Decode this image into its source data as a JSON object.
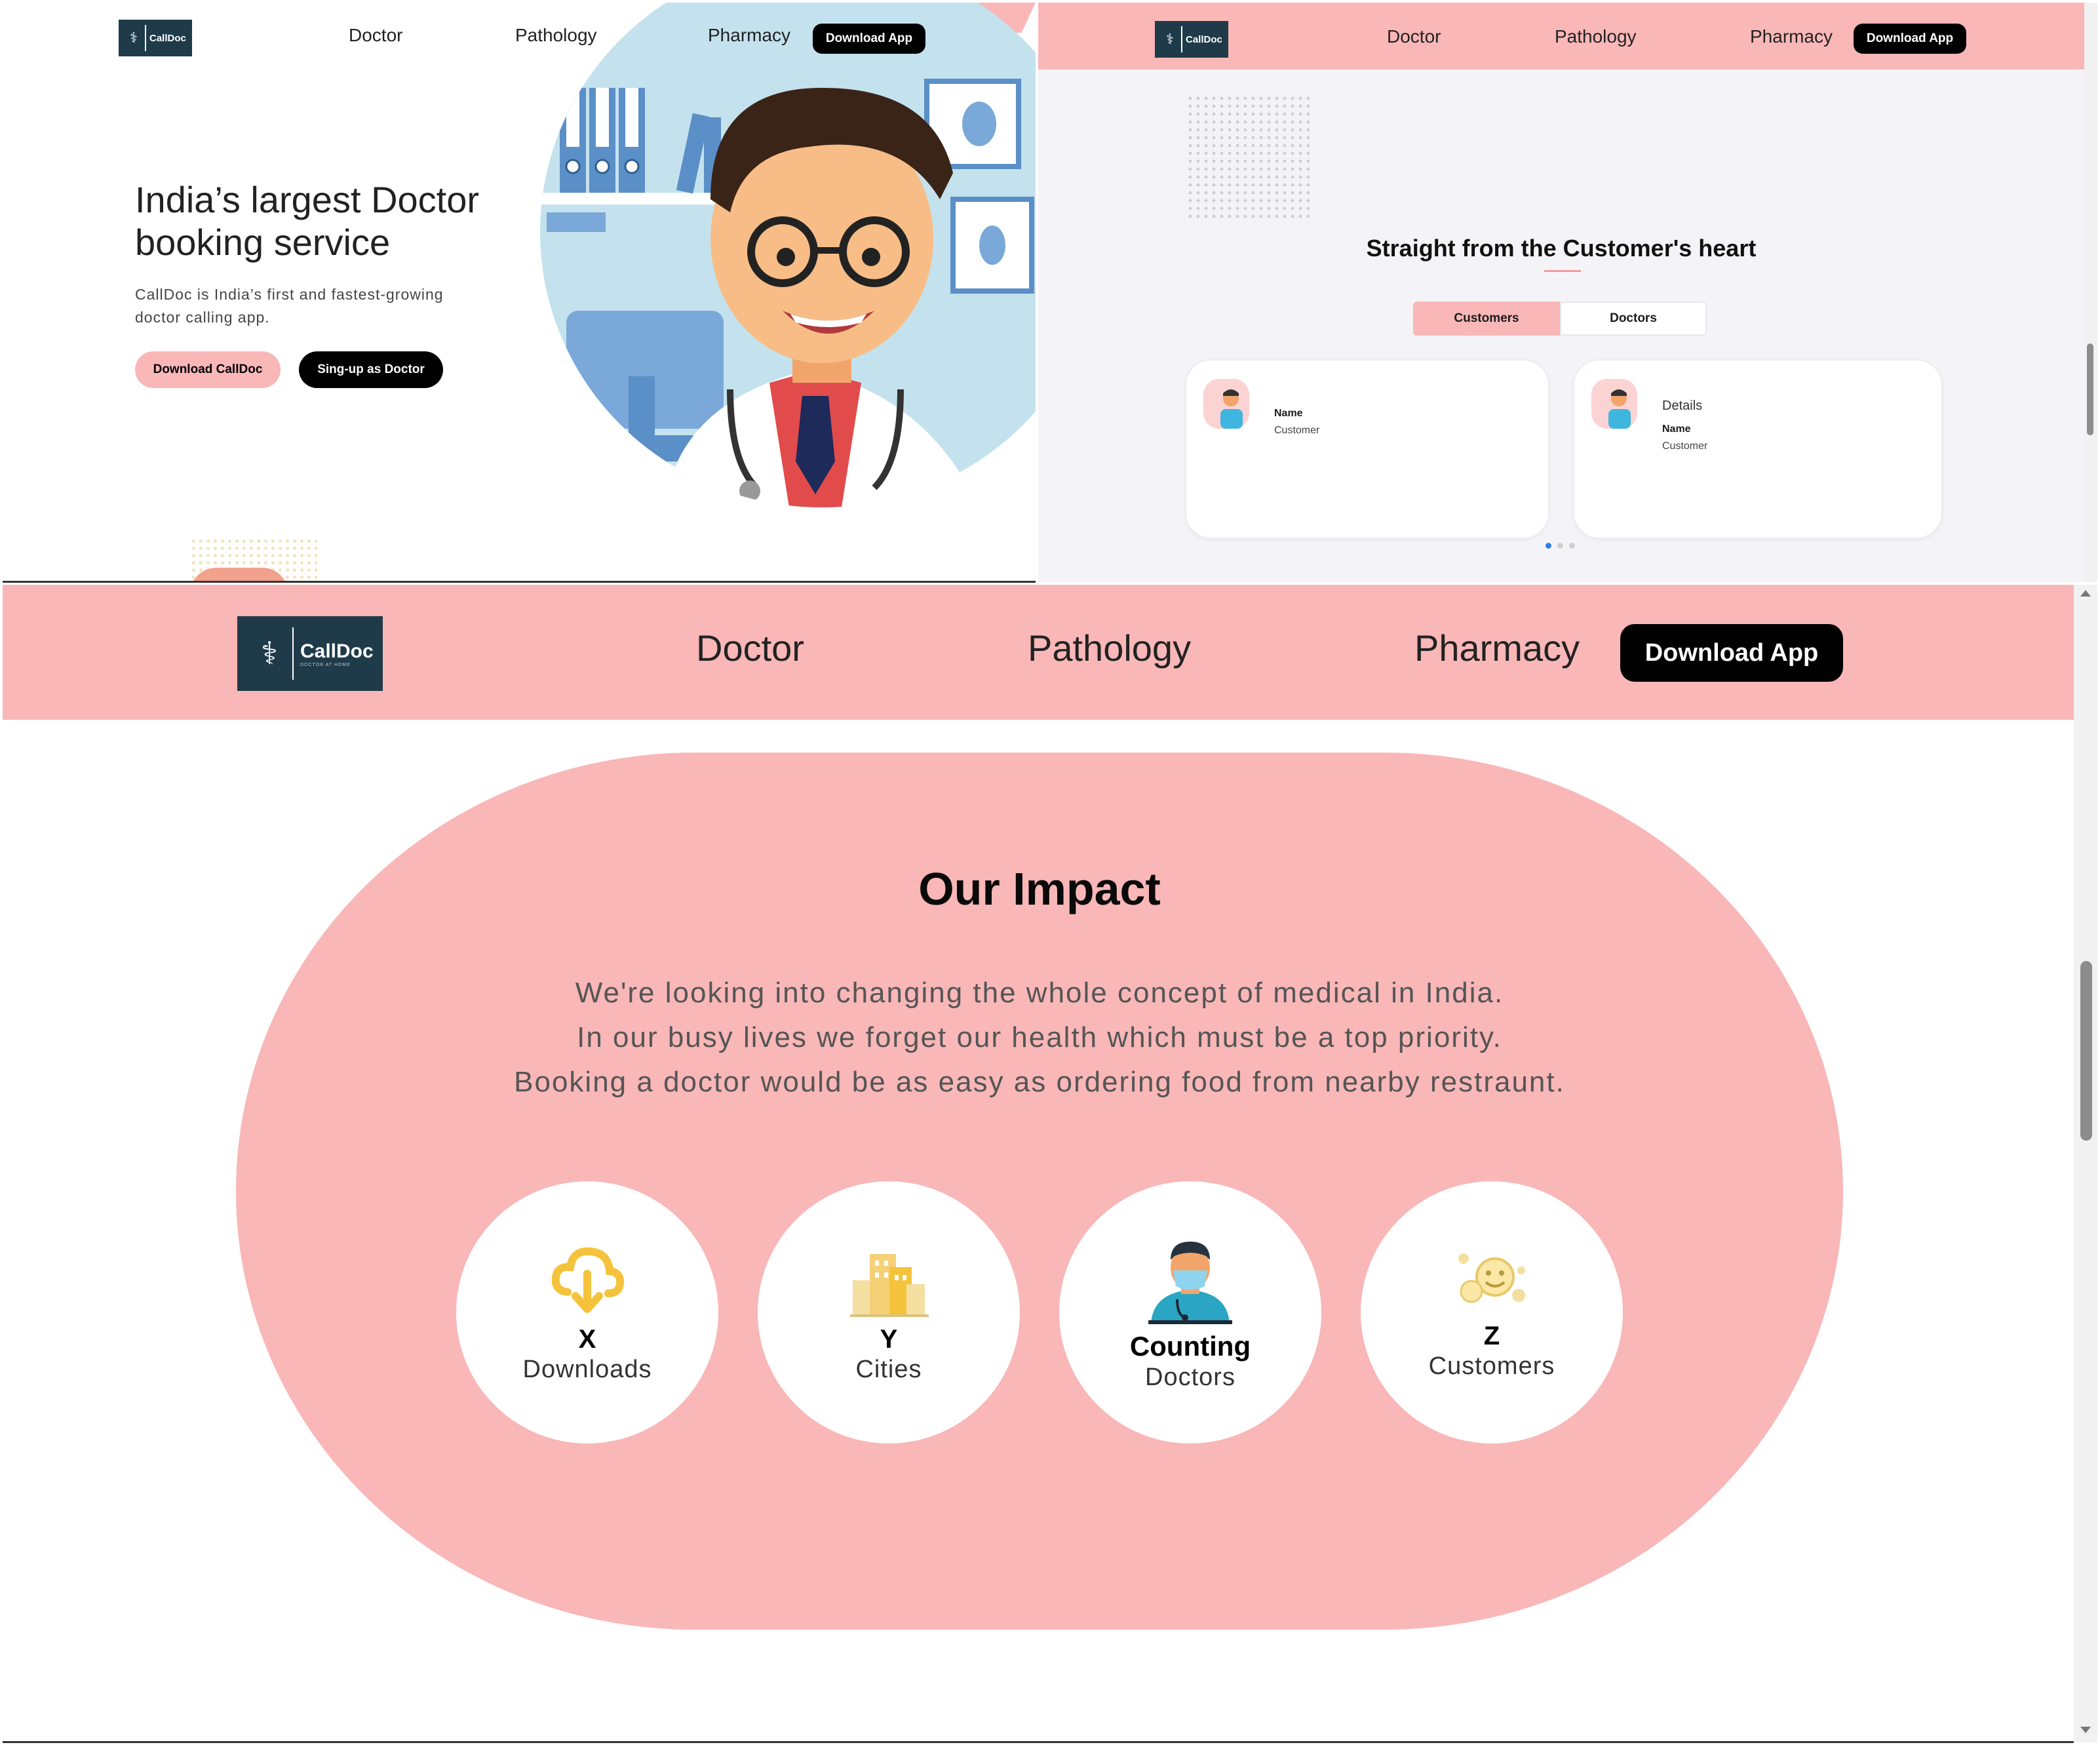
{
  "brand": {
    "name": "CallDoc",
    "tagline": "DOCTOR AT HOME"
  },
  "nav": {
    "doctor": "Doctor",
    "pathology": "Pathology",
    "pharmacy": "Pharmacy",
    "download": "Download App"
  },
  "hero": {
    "title_line1": "India’s largest Doctor",
    "title_line2": "booking service",
    "desc_line1": "CallDoc is India’s first and fastest-growing",
    "desc_line2": "doctor calling app.",
    "btn_download": "Download CallDoc",
    "btn_signup": "Sing-up as Doctor"
  },
  "testimonials": {
    "heading": "Straight from the Customer's heart",
    "tabs": [
      "Customers",
      "Doctors"
    ],
    "card1": {
      "name": "Name",
      "role": "Customer"
    },
    "card2": {
      "details": "Details",
      "name": "Name",
      "role": "Customer"
    }
  },
  "impact": {
    "heading": "Our Impact",
    "line1": "We're looking into changing the whole concept of medical in India.",
    "line2": "In our busy lives we forget our health which must be a top priority.",
    "line3": "Booking a doctor would be as easy as ordering food from nearby restraunt.",
    "stats": [
      {
        "value": "X",
        "label": "Downloads",
        "icon": "cloud-download-icon"
      },
      {
        "value": "Y",
        "label": "Cities",
        "icon": "city-buildings-icon"
      },
      {
        "value": "Counting",
        "label": "Doctors",
        "icon": "doctor-icon"
      },
      {
        "value": "Z",
        "label": "Customers",
        "icon": "happy-faces-icon"
      }
    ]
  },
  "colors": {
    "pink": "#f9b7b7",
    "dark": "#000000",
    "logo_bg": "#1f3b4a"
  }
}
